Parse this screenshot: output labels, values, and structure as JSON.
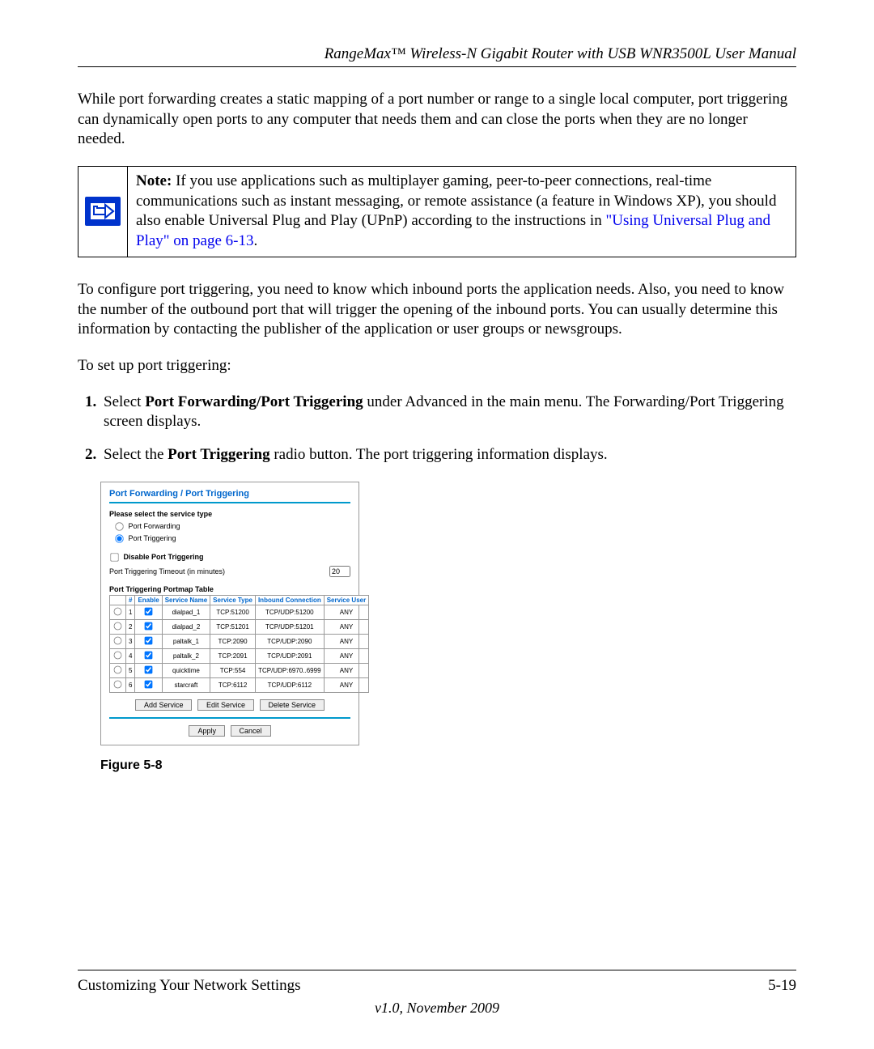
{
  "header": {
    "title": "RangeMax™ Wireless-N Gigabit Router with USB WNR3500L User Manual"
  },
  "body": {
    "para1": "While port forwarding creates a static mapping of a port number or range to a single local computer, port triggering can dynamically open ports to any computer that needs them and can close the ports when they are no longer needed.",
    "note": {
      "label": "Note:",
      "text_a": " If you use applications such as multiplayer gaming, peer-to-peer connections, real-time communications such as instant messaging, or remote assistance (a feature in Windows XP), you should also enable Universal Plug and Play (UPnP) according to the instructions in ",
      "link": "\"Using Universal Plug and Play\" on page 6-13",
      "text_b": "."
    },
    "para2": "To configure port triggering, you need to know which inbound ports the application needs. Also, you need to know the number of the outbound port that will trigger the opening of the inbound ports. You can usually determine this information by contacting the publisher of the application or user groups or newsgroups.",
    "para3": "To set up port triggering:",
    "steps": {
      "s1a": "Select ",
      "s1b": "Port Forwarding/Port Triggering",
      "s1c": " under Advanced in the main menu. The Forwarding/Port Triggering screen displays.",
      "s2a": "Select the ",
      "s2b": "Port Triggering",
      "s2c": " radio button. The port triggering information displays."
    },
    "figure_caption": "Figure 5-8"
  },
  "figure": {
    "title": "Port Forwarding / Port Triggering",
    "select_label": "Please select the service type",
    "radio_forwarding": "Port Forwarding",
    "radio_triggering": "Port Triggering",
    "disable_label": "Disable Port Triggering",
    "timeout_label": "Port Triggering Timeout (in minutes)",
    "timeout_value": "20",
    "table_title": "Port Triggering Portmap Table",
    "columns": {
      "c_num": "#",
      "c_enable": "Enable",
      "c_name": "Service Name",
      "c_type": "Service Type",
      "c_inbound": "Inbound Connection",
      "c_user": "Service User"
    },
    "rows": [
      {
        "n": "1",
        "name": "dialpad_1",
        "type": "TCP:51200",
        "inbound": "TCP/UDP:51200",
        "user": "ANY"
      },
      {
        "n": "2",
        "name": "dialpad_2",
        "type": "TCP:51201",
        "inbound": "TCP/UDP:51201",
        "user": "ANY"
      },
      {
        "n": "3",
        "name": "paltalk_1",
        "type": "TCP:2090",
        "inbound": "TCP/UDP:2090",
        "user": "ANY"
      },
      {
        "n": "4",
        "name": "paltalk_2",
        "type": "TCP:2091",
        "inbound": "TCP/UDP:2091",
        "user": "ANY"
      },
      {
        "n": "5",
        "name": "quicktime",
        "type": "TCP:554",
        "inbound": "TCP/UDP:6970..6999",
        "user": "ANY"
      },
      {
        "n": "6",
        "name": "starcraft",
        "type": "TCP:6112",
        "inbound": "TCP/UDP:6112",
        "user": "ANY"
      }
    ],
    "buttons": {
      "add": "Add Service",
      "edit": "Edit Service",
      "delete": "Delete Service",
      "apply": "Apply",
      "cancel": "Cancel"
    }
  },
  "footer": {
    "left": "Customizing Your Network Settings",
    "right": "5-19",
    "version": "v1.0, November 2009"
  }
}
